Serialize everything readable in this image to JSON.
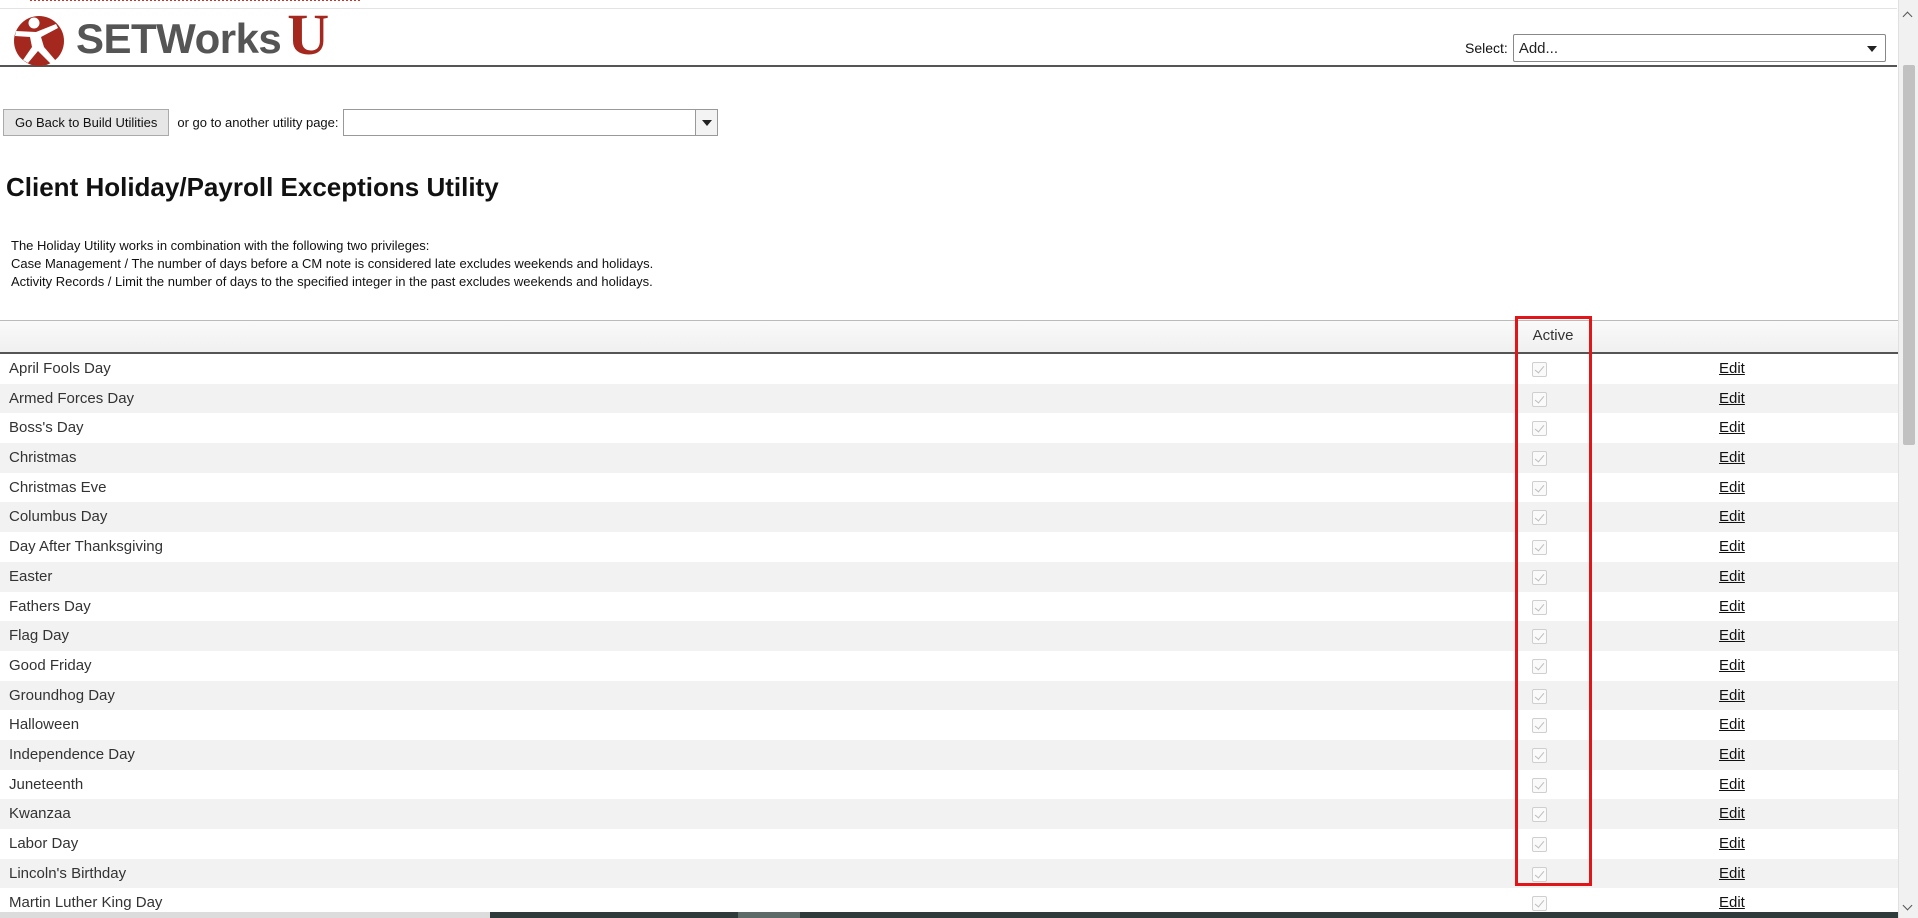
{
  "header": {
    "logo_text": "SETWorks",
    "logo_suffix": "U",
    "select_label": "Select:",
    "select_value": "Add..."
  },
  "toolbar": {
    "back_button": "Go Back to Build Utilities",
    "or_text": "or go to another utility page:",
    "utility_select_value": ""
  },
  "page": {
    "title": "Client Holiday/Payroll Exceptions Utility",
    "description": [
      "The Holiday Utility works in combination with the following two privileges:",
      "Case Management / The number of days before a CM note is considered late excludes weekends and holidays.",
      "Activity Records / Limit the number of days to the specified integer in the past excludes weekends and holidays."
    ]
  },
  "table": {
    "columns": {
      "name": "",
      "active": "Active",
      "actions": ""
    },
    "edit_label": "Edit",
    "rows": [
      {
        "name": "April Fools Day",
        "active": true
      },
      {
        "name": "Armed Forces Day",
        "active": true
      },
      {
        "name": "Boss's Day",
        "active": true
      },
      {
        "name": "Christmas",
        "active": true
      },
      {
        "name": "Christmas Eve",
        "active": true
      },
      {
        "name": "Columbus Day",
        "active": true
      },
      {
        "name": "Day After Thanksgiving",
        "active": true
      },
      {
        "name": "Easter",
        "active": true
      },
      {
        "name": "Fathers Day",
        "active": true
      },
      {
        "name": "Flag Day",
        "active": true
      },
      {
        "name": "Good Friday",
        "active": true
      },
      {
        "name": "Groundhog Day",
        "active": true
      },
      {
        "name": "Halloween",
        "active": true
      },
      {
        "name": "Independence Day",
        "active": true
      },
      {
        "name": "Juneteenth",
        "active": true
      },
      {
        "name": "Kwanzaa",
        "active": true
      },
      {
        "name": "Labor Day",
        "active": true
      },
      {
        "name": "Lincoln's Birthday",
        "active": true
      },
      {
        "name": "Martin Luther King Day",
        "active": true
      }
    ]
  },
  "colors": {
    "brand_red": "#a4281d",
    "highlight_red": "#e0161b",
    "row_alt": "#f2f2f2"
  }
}
